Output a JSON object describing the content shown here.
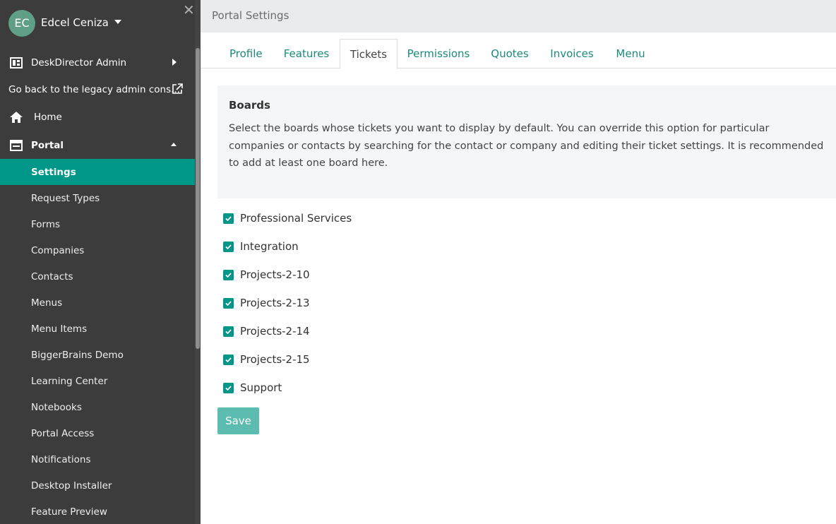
{
  "user": {
    "initials": "EC",
    "name": "Edcel Ceniza"
  },
  "sidebar": {
    "admin_label": "DeskDirector Admin",
    "legacy_label": "Go back to the legacy admin cons...",
    "home_label": "Home",
    "portal_label": "Portal",
    "items": [
      {
        "label": "Settings",
        "active": true
      },
      {
        "label": "Request Types"
      },
      {
        "label": "Forms"
      },
      {
        "label": "Companies"
      },
      {
        "label": "Contacts"
      },
      {
        "label": "Menus"
      },
      {
        "label": "Menu Items"
      },
      {
        "label": "BiggerBrains Demo"
      },
      {
        "label": "Learning Center"
      },
      {
        "label": "Notebooks"
      },
      {
        "label": "Portal Access"
      },
      {
        "label": "Notifications"
      },
      {
        "label": "Desktop Installer"
      },
      {
        "label": "Feature Preview"
      }
    ]
  },
  "header": {
    "title": "Portal Settings"
  },
  "tabs": [
    {
      "label": "Profile"
    },
    {
      "label": "Features"
    },
    {
      "label": "Tickets",
      "active": true
    },
    {
      "label": "Permissions"
    },
    {
      "label": "Quotes"
    },
    {
      "label": "Invoices"
    },
    {
      "label": "Menu"
    }
  ],
  "boards": {
    "title": "Boards",
    "description": "Select the boards whose tickets you want to display by default. You can override this option for particular companies or contacts by searching for the contact or company and editing their ticket settings. It is recommended to add at least one board here.",
    "options": [
      {
        "label": "Professional Services",
        "checked": true
      },
      {
        "label": "Integration",
        "checked": true
      },
      {
        "label": "Projects-2-10",
        "checked": true
      },
      {
        "label": "Projects-2-13",
        "checked": true
      },
      {
        "label": "Projects-2-14",
        "checked": true
      },
      {
        "label": "Projects-2-15",
        "checked": true
      },
      {
        "label": "Support",
        "checked": true
      }
    ]
  },
  "save_label": "Save",
  "colors": {
    "accent": "#009688",
    "sidebar_bg": "#3c3c3c",
    "save_bg": "#5dbcb0"
  }
}
